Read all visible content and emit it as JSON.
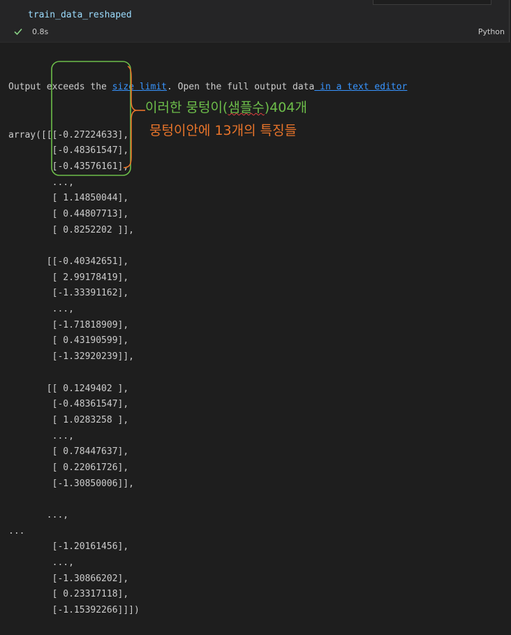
{
  "cell": {
    "code": "train_data_reshaped",
    "exec_time": "0.8s",
    "language": "Python",
    "status_icon": "check-icon"
  },
  "output": {
    "notice_prefix": "Output exceeds the ",
    "size_limit_link": "size limit",
    "notice_middle": ". Open the full output data",
    "text_editor_link": " in a text editor",
    "lines": [
      "array([[[-0.27224633],",
      "        [-0.48361547],",
      "        [-0.43576161],",
      "        ...,",
      "        [ 1.14850044],",
      "        [ 0.44807713],",
      "        [ 0.8252202 ]],",
      "",
      "       [[-0.40342651],",
      "        [ 2.99178419],",
      "        [-1.33391162],",
      "        ...,",
      "        [-1.71818909],",
      "        [ 0.43190599],",
      "        [-1.32920239]],",
      "",
      "       [[ 0.1249402 ],",
      "        [-0.48361547],",
      "        [ 1.0283258 ],",
      "        ...,",
      "        [ 0.78447637],",
      "        [ 0.22061726],",
      "        [-1.30850006]],",
      "",
      "       ...,",
      "...",
      "        [-1.20161456],",
      "        ...,",
      "        [-1.30866202],",
      "        [ 0.23317118],",
      "        [-1.15392266]]])"
    ]
  },
  "annotations": {
    "line1_before": "이러한 뭉텅이(",
    "line1_wavy": "샘플수",
    "line1_after": ")404개",
    "line2": "뭉텅이안에 13개의 특징들",
    "colors": {
      "green": "#6dbe4a",
      "orange": "#e8742a"
    }
  }
}
